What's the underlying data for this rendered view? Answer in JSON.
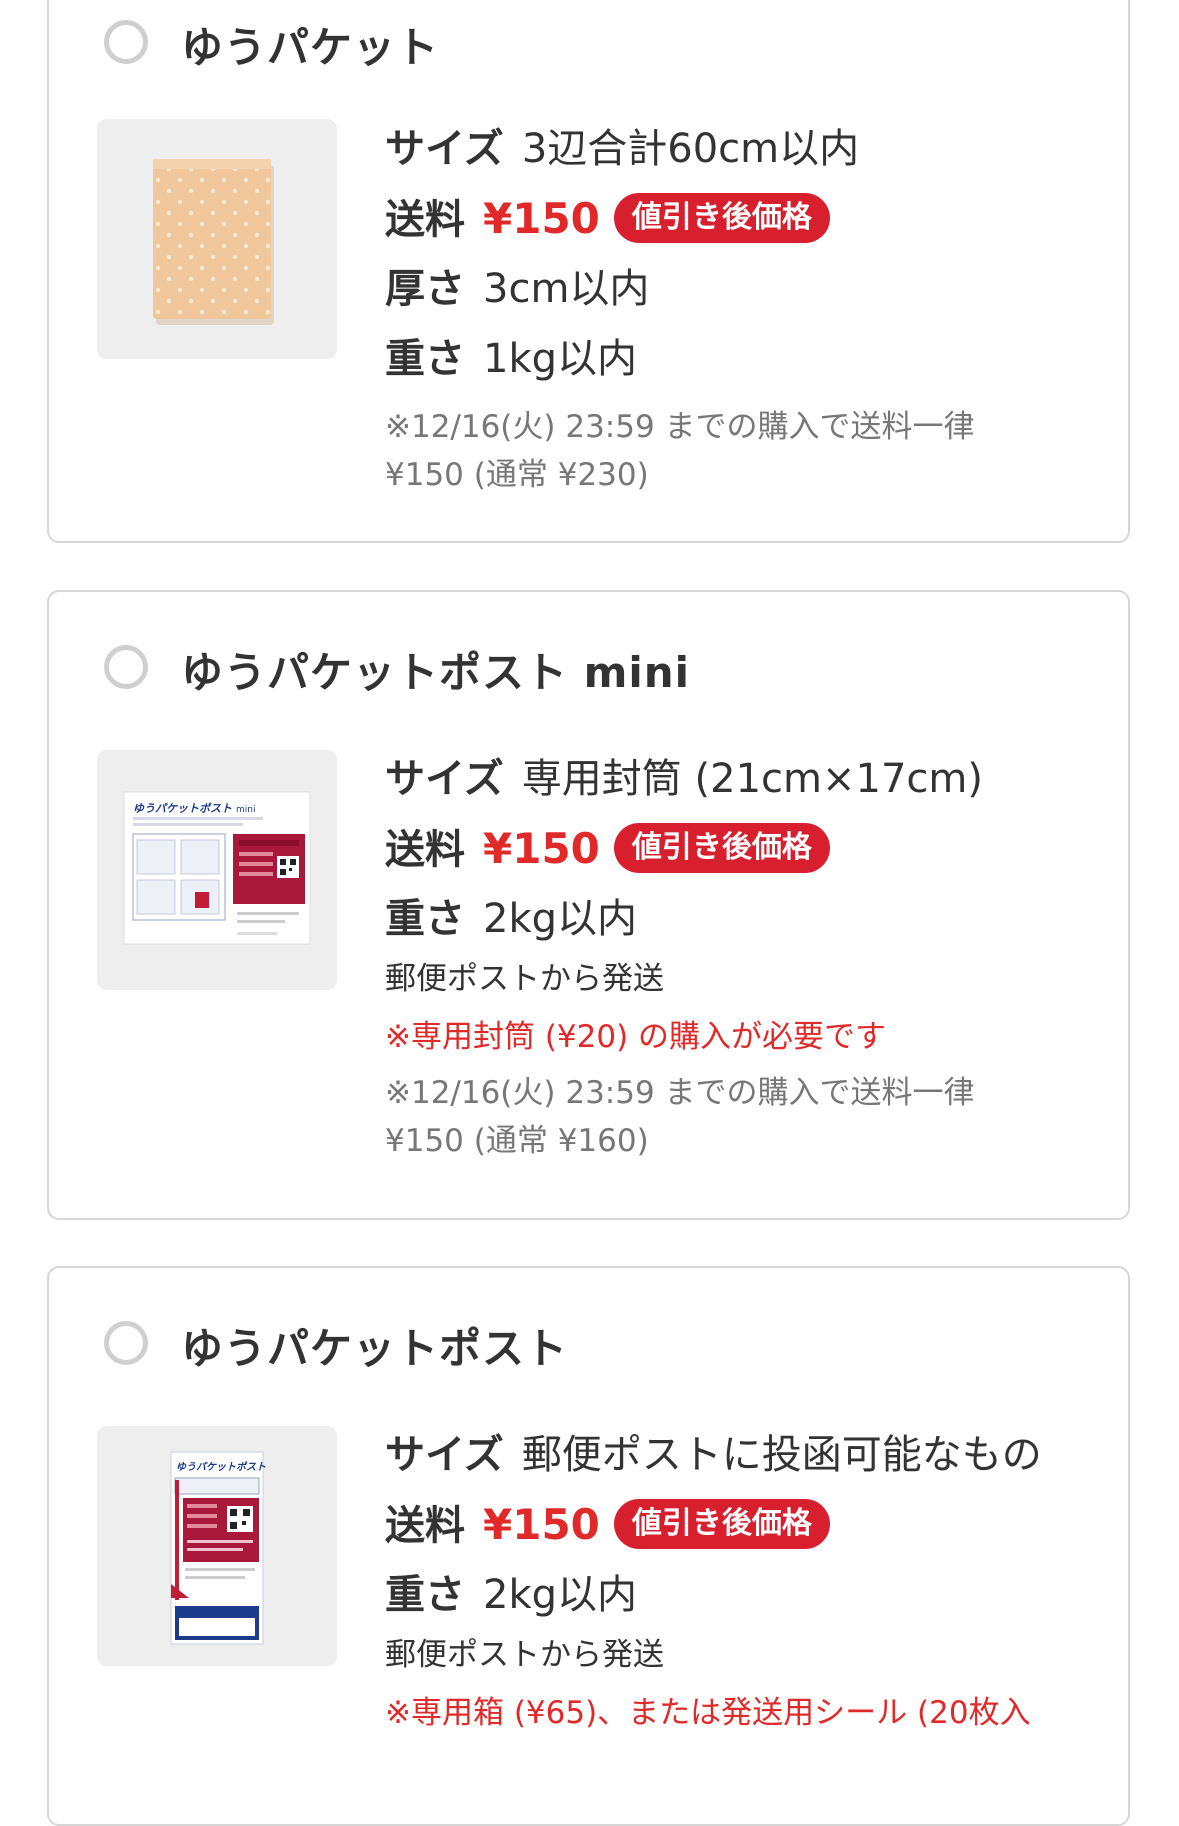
{
  "options": [
    {
      "title": "ゆうパケット",
      "size_label": "サイズ",
      "size_value": "3辺合計60cm以内",
      "fee_label": "送料",
      "fee_price": "¥150",
      "fee_badge": "値引き後価格",
      "thickness_label": "厚さ",
      "thickness_value": "3cm以内",
      "weight_label": "重さ",
      "weight_value": "1kg以内",
      "note_line1": "※12/16(火) 23:59 までの購入で送料一律",
      "note_line2": "¥150 (通常 ¥230)"
    },
    {
      "title": "ゆうパケットポスト mini",
      "size_label": "サイズ",
      "size_value": "専用封筒 (21cm×17cm)",
      "fee_label": "送料",
      "fee_price": "¥150",
      "fee_badge": "値引き後価格",
      "weight_label": "重さ",
      "weight_value": "2kg以内",
      "shipping_text": "郵便ポストから発送",
      "warning_text": "※専用封筒 (¥20) の購入が必要です",
      "note_line1": "※12/16(火) 23:59 までの購入で送料一律",
      "note_line2": "¥150 (通常 ¥160)",
      "envelope_title": "ゆうパケットポスト",
      "envelope_suffix": "mini"
    },
    {
      "title": "ゆうパケットポスト",
      "size_label": "サイズ",
      "size_value": "郵便ポストに投函可能なもの",
      "fee_label": "送料",
      "fee_price": "¥150",
      "fee_badge": "値引き後価格",
      "weight_label": "重さ",
      "weight_value": "2kg以内",
      "shipping_text": "郵便ポストから発送",
      "warning_text": "※専用箱 (¥65)、または発送用シール (20枚入",
      "label_title": "ゆうパケットポスト"
    }
  ],
  "colors": {
    "accent_red": "#e02a2a",
    "badge_red": "#d81f2e",
    "border": "#d6d6d6",
    "thumb_bg": "#eeeeee"
  },
  "icons": [
    "radio-unselected-icon",
    "mailer-envelope-image",
    "mini-envelope-image",
    "post-label-image"
  ]
}
